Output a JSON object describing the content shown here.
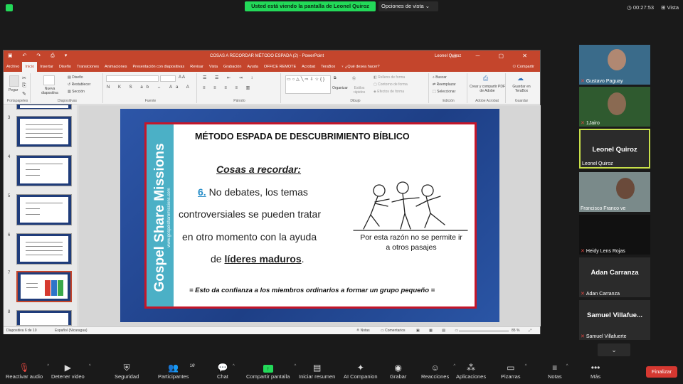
{
  "zoom": {
    "share_banner": "Usted está viendo la pantalla de Leonel Quiroz",
    "view_options": "Opciones de vista",
    "timer": "00:27:53",
    "view_label": "Vista"
  },
  "ppt": {
    "doc_title": "COSAS A RECORDAR MÉTODO ESPADA (2) - PowerPoint",
    "user": "Leonel Quiroz",
    "tabs": [
      "Archivo",
      "Inicio",
      "Insertar",
      "Diseño",
      "Transiciones",
      "Animaciones",
      "Presentación con diapositivas",
      "Revisar",
      "Vista",
      "Grabación",
      "Ayuda",
      "OFFICE REMOTE",
      "Acrobat",
      "TeraBox",
      "¿Qué desea hacer?"
    ],
    "share": "Compartir",
    "ribbon": {
      "paste": "Pegar",
      "new_slide": "Nueva diapositiva",
      "layout": "Diseño",
      "reset": "Restablecer",
      "section": "Sección",
      "group_clipboard": "Portapapeles",
      "group_slides": "Diapositivas",
      "group_font": "Fuente",
      "group_paragraph": "Párrafo",
      "group_drawing": "Dibujo",
      "group_edit": "Edición",
      "group_adobe": "Adobe Acrobat",
      "group_save": "Guardar",
      "arrange": "Organizar",
      "quick_styles": "Estilos rápidos",
      "shape_fill": "Relleno de forma",
      "shape_outline": "Contorno de forma",
      "shape_effects": "Efectos de forma",
      "find": "Buscar",
      "replace": "Reemplazar",
      "select": "Seleccionar",
      "create_pdf": "Crear y compartir PDF de Adobe",
      "save_terabox": "Guardar en TeraBox"
    },
    "thumbs": [
      "3",
      "4",
      "5",
      "6",
      "7",
      "8"
    ],
    "status": {
      "slide": "Diapositiva 6 de 10",
      "lang": "Español (Nicaragua)",
      "notes": "Notas",
      "comments": "Comentarios",
      "zoom": "85 %"
    }
  },
  "slide": {
    "vertical_title": "Gospel Share Missions",
    "vertical_url": "www.gospelsharemissions.com",
    "title": "MÉTODO ESPADA DE DESCUBRIMIENTO BÍBLICO",
    "subtitle": "Cosas a recordar:",
    "num": "6.",
    "line1": " No debates, los temas",
    "line2": "controversiales se pueden tratar",
    "line3": "en otro momento con la ayuda",
    "line4_pre": "de ",
    "line4_bold": "líderes maduros",
    "line4_post": ".",
    "caption": "Por esta razón no se permite ir a otros pasajes",
    "footer": "= Esto da confianza a los miembros ordinarios a formar un grupo pequeño ="
  },
  "participants": [
    {
      "name": "Gustavo Paguay",
      "muted": true,
      "video": true
    },
    {
      "name": "1Jairo",
      "muted": true,
      "video": true
    },
    {
      "name": "Leonel Quiroz",
      "big": "Leonel Quiroz",
      "muted": false,
      "active": true
    },
    {
      "name": "Francisco Franco ve",
      "muted": false,
      "video": true
    },
    {
      "name": "Heidy Lens Rojas",
      "muted": true
    },
    {
      "name": "Adan Carranza",
      "big": "Adan Carranza",
      "muted": true
    },
    {
      "name": "Samuel Villafuerte",
      "big": "Samuel  Villafue...",
      "muted": true
    }
  ],
  "toolbar": {
    "audio": "Reactivar audio",
    "video": "Detener video",
    "security": "Seguridad",
    "participants": "Participantes",
    "participants_count": "16",
    "chat": "Chat",
    "share": "Compartir pantalla",
    "summary": "Iniciar resumen",
    "companion": "AI Companion",
    "record": "Grabar",
    "reactions": "Reacciones",
    "apps": "Aplicaciones",
    "whiteboards": "Pizarras",
    "notes": "Notas",
    "more": "Más",
    "end": "Finalizar"
  }
}
